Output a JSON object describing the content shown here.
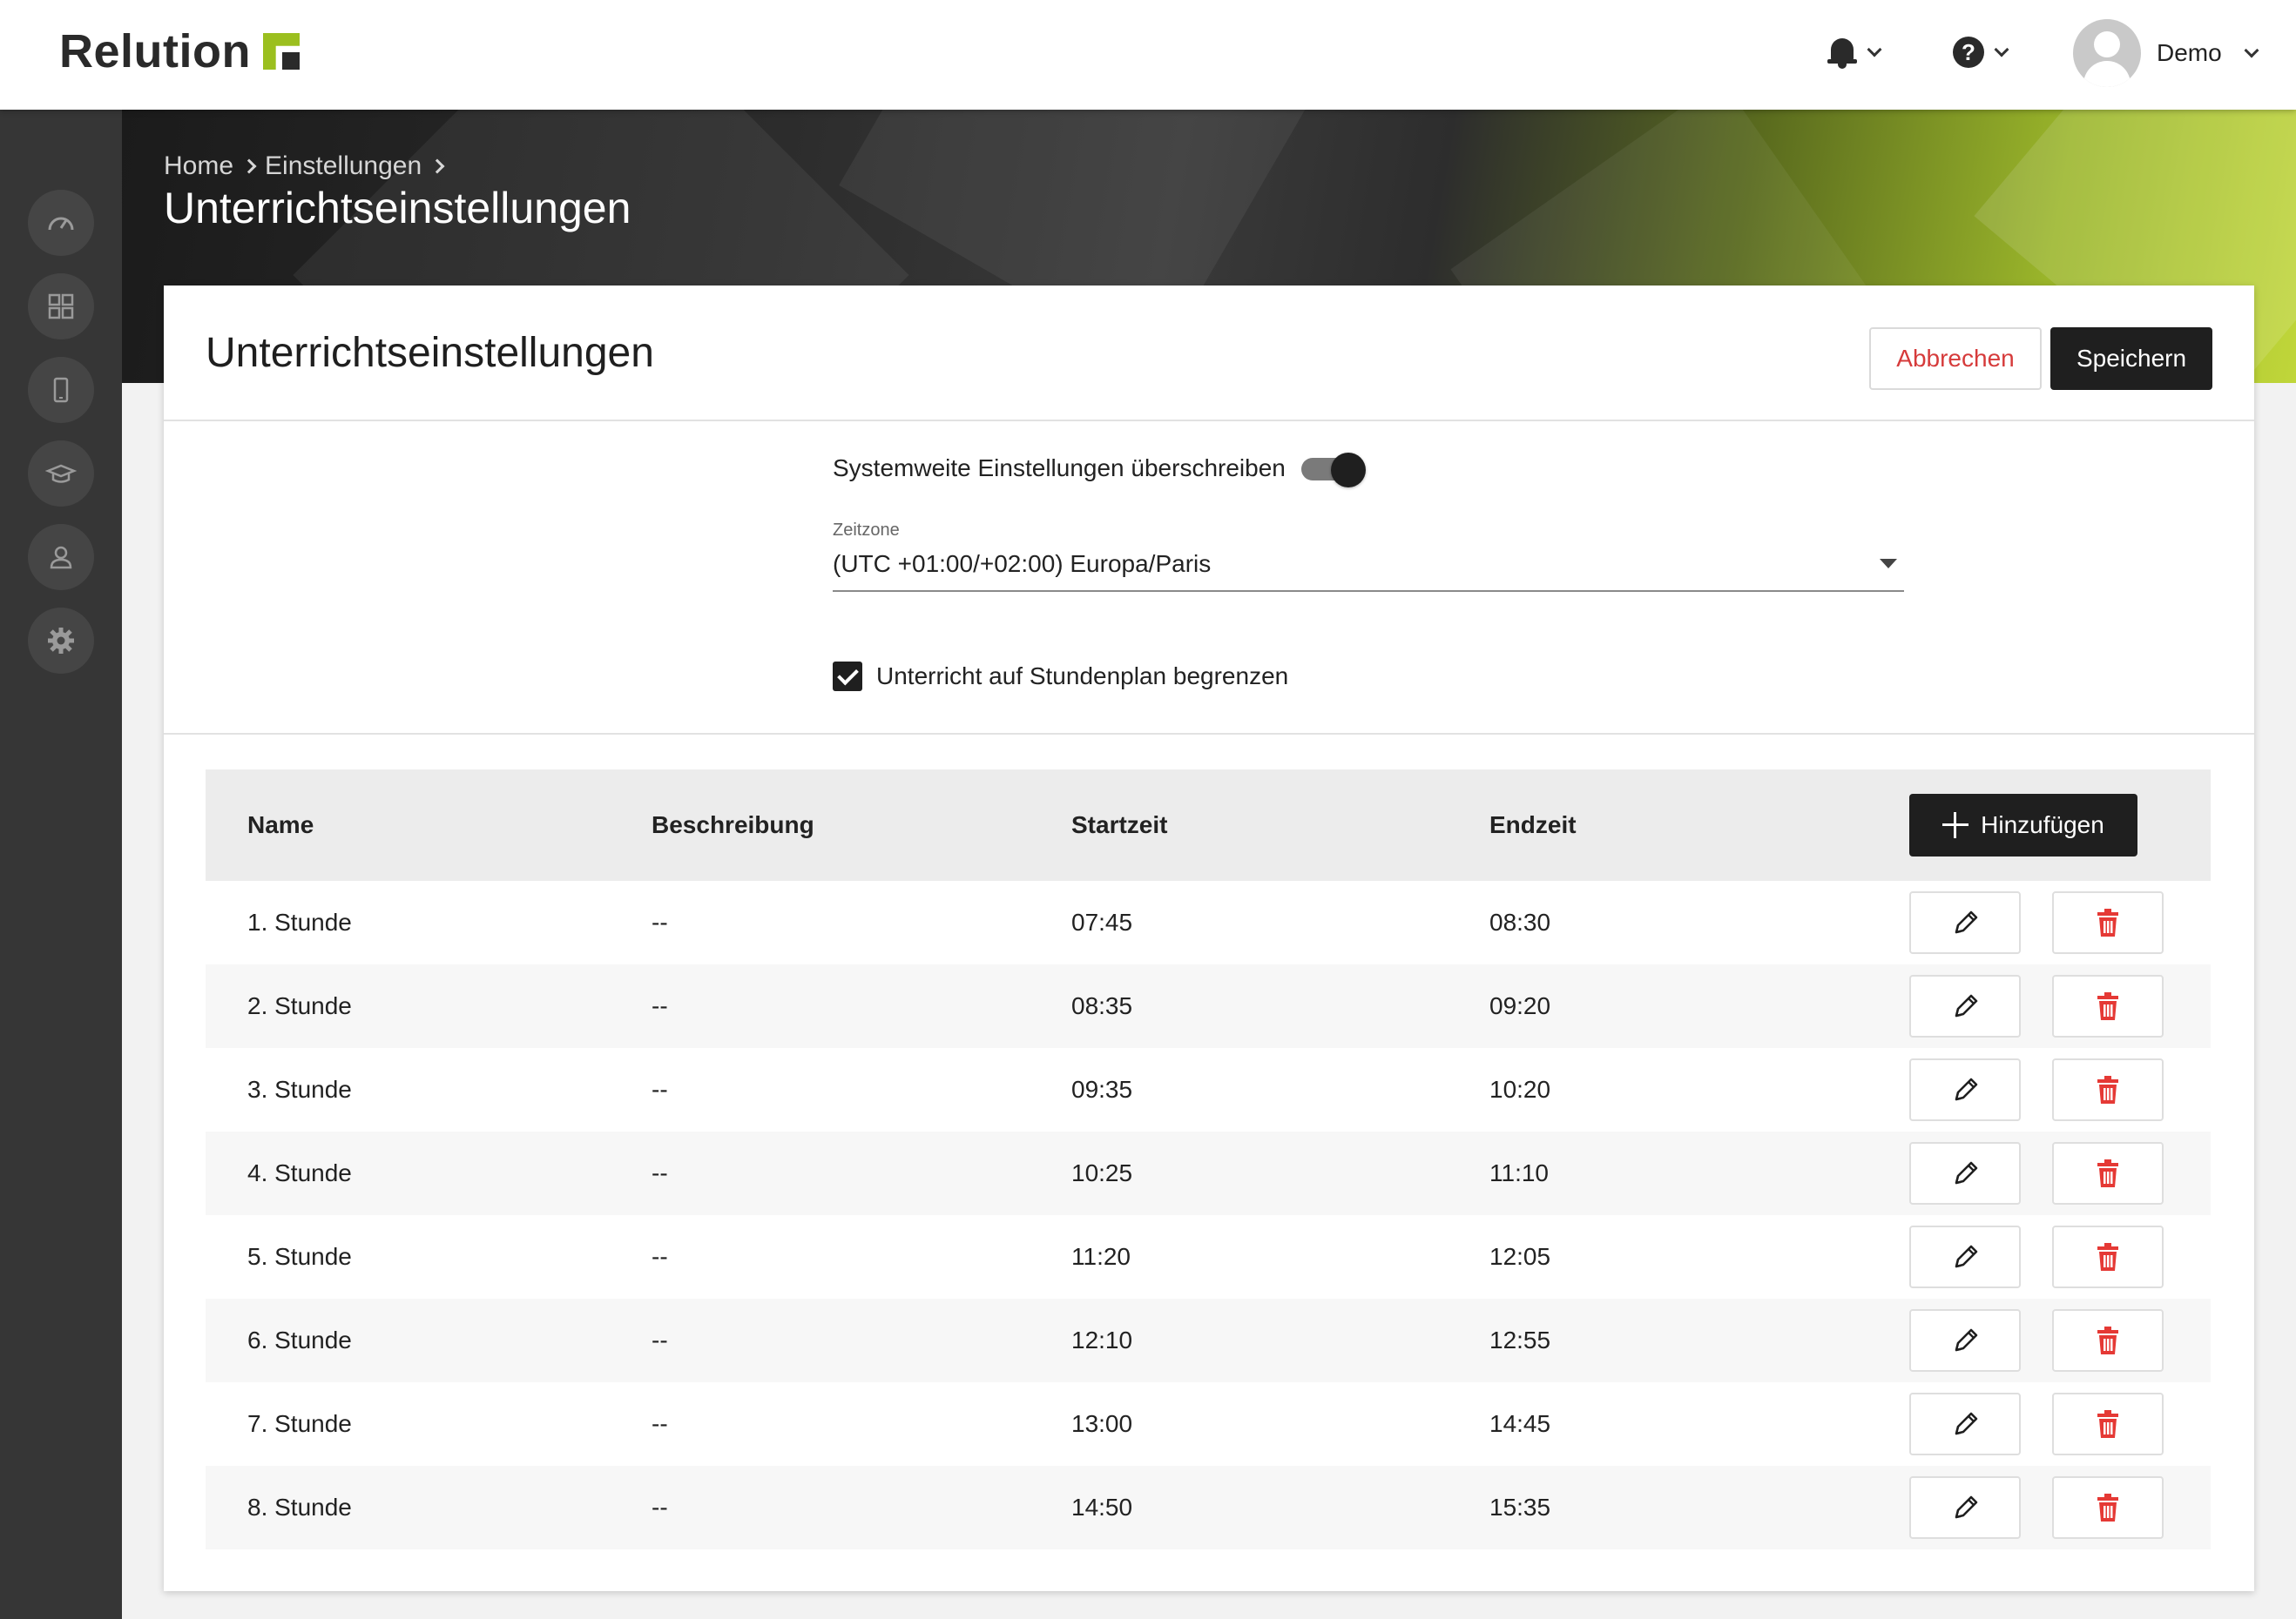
{
  "app": {
    "brand": "Relution",
    "user_name": "Demo"
  },
  "topbar": {
    "notifications_icon": "bell-icon",
    "help_icon": "help-icon",
    "avatar_icon": "user-avatar-icon"
  },
  "sidebar": {
    "items": [
      {
        "name": "dashboard",
        "icon": "gauge-icon"
      },
      {
        "name": "apps",
        "icon": "grid-icon"
      },
      {
        "name": "devices",
        "icon": "smartphone-icon"
      },
      {
        "name": "education",
        "icon": "graduation-cap-icon"
      },
      {
        "name": "users",
        "icon": "user-icon"
      },
      {
        "name": "settings",
        "icon": "gear-icon"
      }
    ]
  },
  "breadcrumb": {
    "items": [
      "Home",
      "Einstellungen"
    ]
  },
  "hero": {
    "title": "Unterrichtseinstellungen"
  },
  "card": {
    "title": "Unterrichtseinstellungen",
    "cancel_label": "Abbrechen",
    "save_label": "Speichern"
  },
  "settings": {
    "override_label": "Systemweite Einstellungen überschreiben",
    "override_enabled": true,
    "timezone_label": "Zeitzone",
    "timezone_value": "(UTC +01:00/+02:00) Europa/Paris",
    "limit_label": "Unterricht auf Stundenplan begrenzen",
    "limit_checked": true
  },
  "table": {
    "headers": {
      "name": "Name",
      "description": "Beschreibung",
      "start": "Startzeit",
      "end": "Endzeit"
    },
    "add_label": "Hinzufügen",
    "rows": [
      {
        "name": "1. Stunde",
        "description": "--",
        "start": "07:45",
        "end": "08:30"
      },
      {
        "name": "2. Stunde",
        "description": "--",
        "start": "08:35",
        "end": "09:20"
      },
      {
        "name": "3. Stunde",
        "description": "--",
        "start": "09:35",
        "end": "10:20"
      },
      {
        "name": "4. Stunde",
        "description": "--",
        "start": "10:25",
        "end": "11:10"
      },
      {
        "name": "5. Stunde",
        "description": "--",
        "start": "11:20",
        "end": "12:05"
      },
      {
        "name": "6. Stunde",
        "description": "--",
        "start": "12:10",
        "end": "12:55"
      },
      {
        "name": "7. Stunde",
        "description": "--",
        "start": "13:00",
        "end": "14:45"
      },
      {
        "name": "8. Stunde",
        "description": "--",
        "start": "14:50",
        "end": "15:35"
      }
    ]
  },
  "colors": {
    "brand_green": "#9bbf1f",
    "danger": "#e53935",
    "dark": "#1f1f1f",
    "sidebar": "#363636"
  }
}
